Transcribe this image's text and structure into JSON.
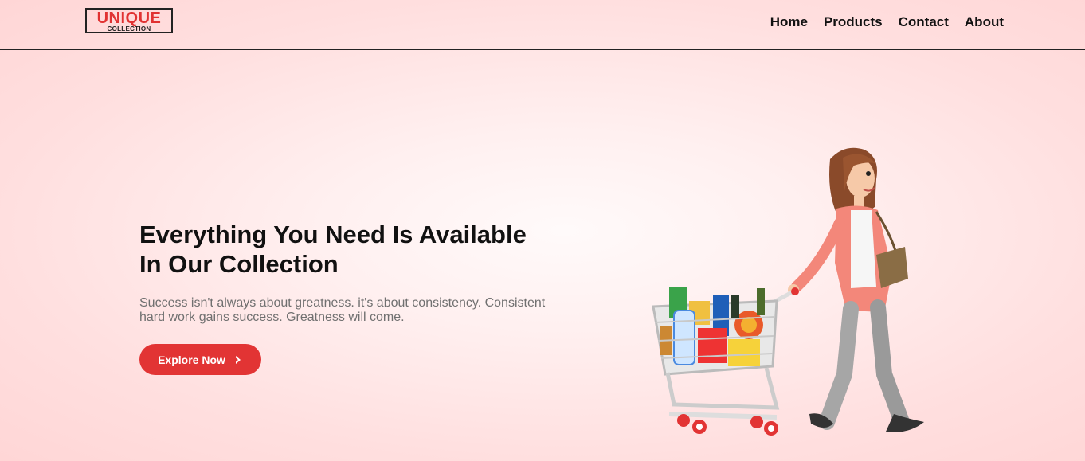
{
  "brand": {
    "name": "UNIQUE",
    "tagline": "COLLECTION",
    "accent": "#e13232"
  },
  "nav": {
    "items": [
      {
        "label": "Home"
      },
      {
        "label": "Products"
      },
      {
        "label": "Contact"
      },
      {
        "label": "About"
      }
    ]
  },
  "hero": {
    "title_line1": "Everything You Need Is Available",
    "title_line2": "In Our Collection",
    "description": "Success isn't always about greatness. it's about consistency. Consistent hard work gains success. Greatness will come.",
    "cta_label": "Explore Now",
    "cta_icon": "chevron-right-icon",
    "illustration": "woman-with-shopping-cart-illustration"
  },
  "colors": {
    "cta": "#e23434",
    "text": "#111111",
    "muted": "#707070"
  }
}
